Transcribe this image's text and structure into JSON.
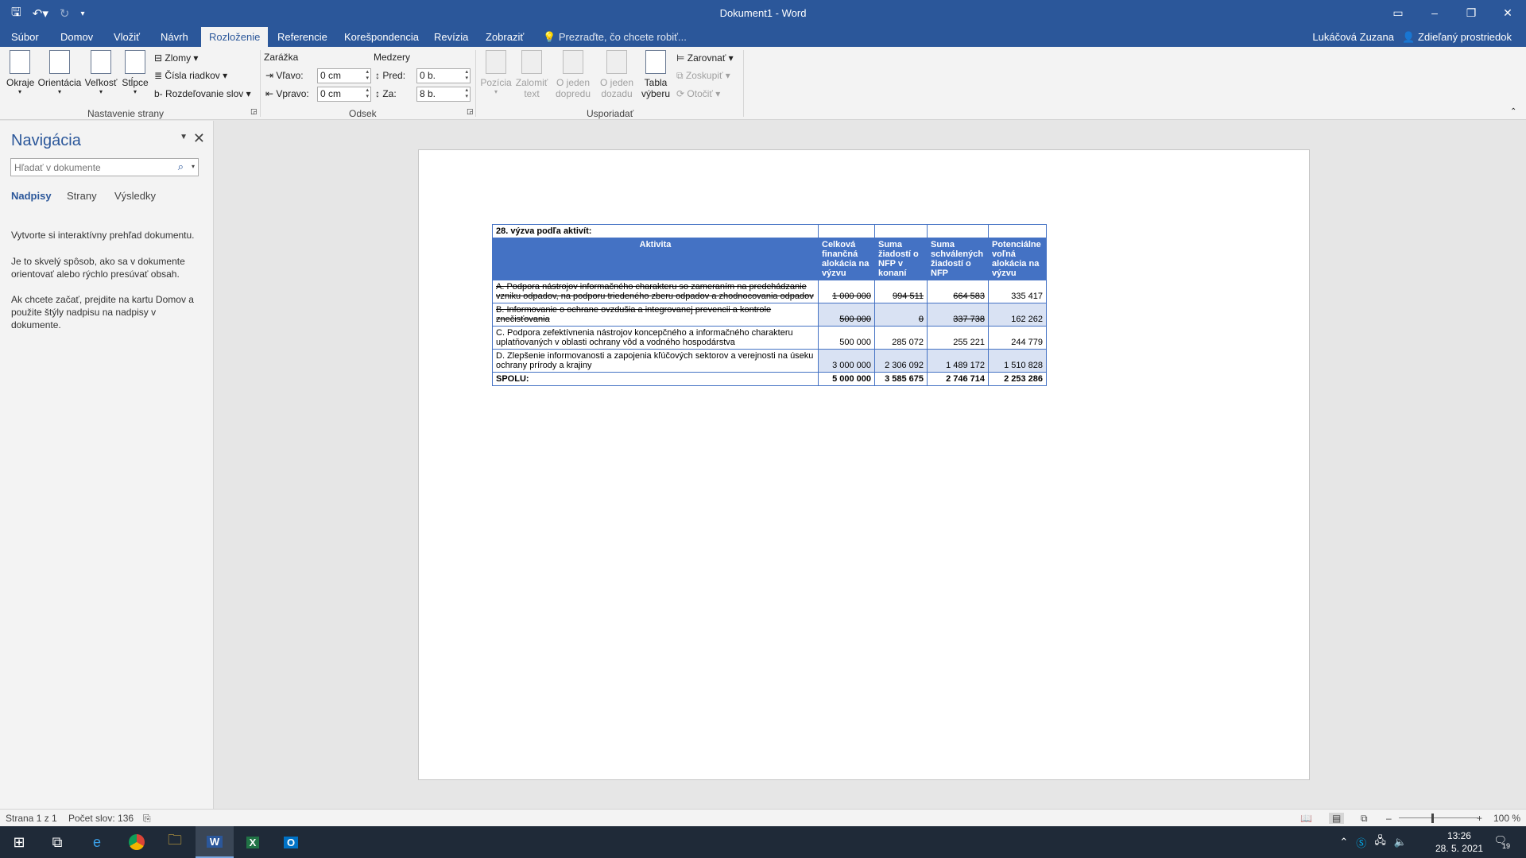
{
  "window": {
    "title": "Dokument1 - Word"
  },
  "tabs": [
    "Súbor",
    "Domov",
    "Vložiť",
    "Návrh",
    "Rozloženie",
    "Referencie",
    "Korešpondencia",
    "Revízia",
    "Zobraziť"
  ],
  "active_tab": "Rozloženie",
  "tell_me": "Prezraďte, čo chcete robiť...",
  "user": "Lukáčová Zuzana",
  "share": "Zdieľaný prostriedok",
  "ribbon": {
    "page_setup": {
      "margins": "Okraje",
      "orientation": "Orientácia",
      "size": "Veľkosť",
      "columns": "Stĺpce",
      "breaks": "Zlomy",
      "line_numbers": "Čísla riadkov",
      "hyphenation": "Rozdeľovanie slov",
      "label": "Nastavenie strany"
    },
    "paragraph": {
      "indent_title": "Zarážka",
      "spacing_title": "Medzery",
      "left_label": "Vľavo:",
      "left_value": "0 cm",
      "right_label": "Vpravo:",
      "right_value": "0 cm",
      "before_label": "Pred:",
      "before_value": "0 b.",
      "after_label": "Za:",
      "after_value": "8 b.",
      "label": "Odsek"
    },
    "arrange": {
      "position_1": "Pozícia",
      "wrap_1": "Zalomiť",
      "wrap_2": "text",
      "forward_1": "O jeden",
      "forward_2": "dopredu",
      "backward_1": "O jeden",
      "backward_2": "dozadu",
      "pane_1": "Tabla",
      "pane_2": "výberu",
      "align": "Zarovnať",
      "group": "Zoskupiť",
      "rotate": "Otočiť",
      "label": "Usporiadať"
    }
  },
  "nav": {
    "title": "Navigácia",
    "search_placeholder": "Hľadať v dokumente",
    "tabs": [
      "Nadpisy",
      "Strany",
      "Výsledky"
    ],
    "text1": "Vytvorte si interaktívny prehľad dokumentu.",
    "text2": "Je to skvelý spôsob, ako sa v dokumente orientovať alebo rýchlo presúvať obsah.",
    "text3": "Ak chcete začať, prejdite na kartu Domov a použite štýly nadpisu na nadpisy v dokumente."
  },
  "table": {
    "caption": "28. výzva podľa aktivít:",
    "headers": [
      "Aktivita",
      "Celková finančná alokácia na výzvu",
      "Suma žiadostí o NFP v konaní",
      "Suma schválených žiadostí o NFP",
      "Potenciálne voľná alokácia na výzvu"
    ],
    "rows": [
      {
        "activity": "A. Podpora nástrojov informačného charakteru so zameraním na predchádzanie vzniku odpadov, na podporu triedeného zberu odpadov a zhodnocovania odpadov",
        "c1": "1 000 000",
        "c2": "994 511",
        "c3": "664 583",
        "c4": "335 417"
      },
      {
        "activity": "B. Informovanie o ochrane ovzdušia a integrovanej prevencii a kontrole znečisťovania",
        "c1": "500 000",
        "c2": "0",
        "c3": "337 738",
        "c4": "162 262"
      },
      {
        "activity": "C. Podpora zefektívnenia nástrojov koncepčného a informačného charakteru uplatňovaných v oblasti ochrany vôd a vodného hospodárstva",
        "c1": "500 000",
        "c2": "285 072",
        "c3": "255 221",
        "c4": "244 779"
      },
      {
        "activity": "D. Zlepšenie informovanosti a zapojenia kľúčových sektorov a verejnosti na úseku ochrany prírody a krajiny",
        "c1": "3 000 000",
        "c2": "2 306 092",
        "c3": "1 489 172",
        "c4": "1 510 828"
      }
    ],
    "total": {
      "label": "SPOLU:",
      "c1": "5 000 000",
      "c2": "3 585 675",
      "c3": "2 746 714",
      "c4": "2 253 286"
    }
  },
  "status": {
    "page": "Strana 1 z 1",
    "words": "Počet slov: 136",
    "zoom": "100 %"
  },
  "taskbar": {
    "time": "13:26",
    "date": "28. 5. 2021",
    "notifications": "19"
  }
}
